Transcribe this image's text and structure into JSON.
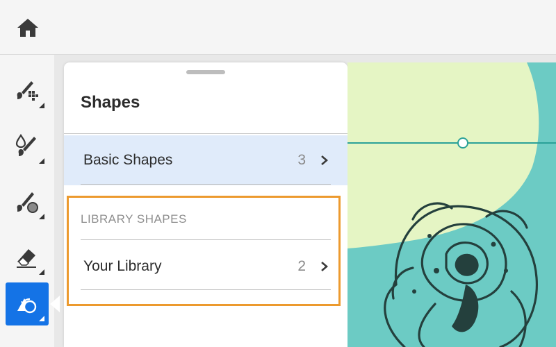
{
  "home": {
    "icon": "home-icon"
  },
  "toolbar": {
    "tools": [
      {
        "name": "pixel-brush-tool",
        "icon": "pixel-brush-icon",
        "active": false
      },
      {
        "name": "watercolor-brush-tool",
        "icon": "watercolor-brush-icon",
        "active": false
      },
      {
        "name": "paint-brush-tool",
        "icon": "paint-brush-icon",
        "active": false
      },
      {
        "name": "eraser-tool",
        "icon": "eraser-icon",
        "active": false
      },
      {
        "name": "shapes-tool",
        "icon": "shapes-icon",
        "active": true
      }
    ],
    "accent": "#1473e6"
  },
  "panel": {
    "title": "Shapes",
    "basic": {
      "label": "Basic Shapes",
      "count": "3"
    },
    "library_header": "LIBRARY SHAPES",
    "library": {
      "label": "Your Library",
      "count": "2"
    },
    "highlight_color": "#ec9a2e"
  },
  "canvas": {
    "colors": {
      "teal": "#6ccbc4",
      "pale_green": "#e5f5c4",
      "line": "#2aa198",
      "ink": "#24403d"
    }
  }
}
